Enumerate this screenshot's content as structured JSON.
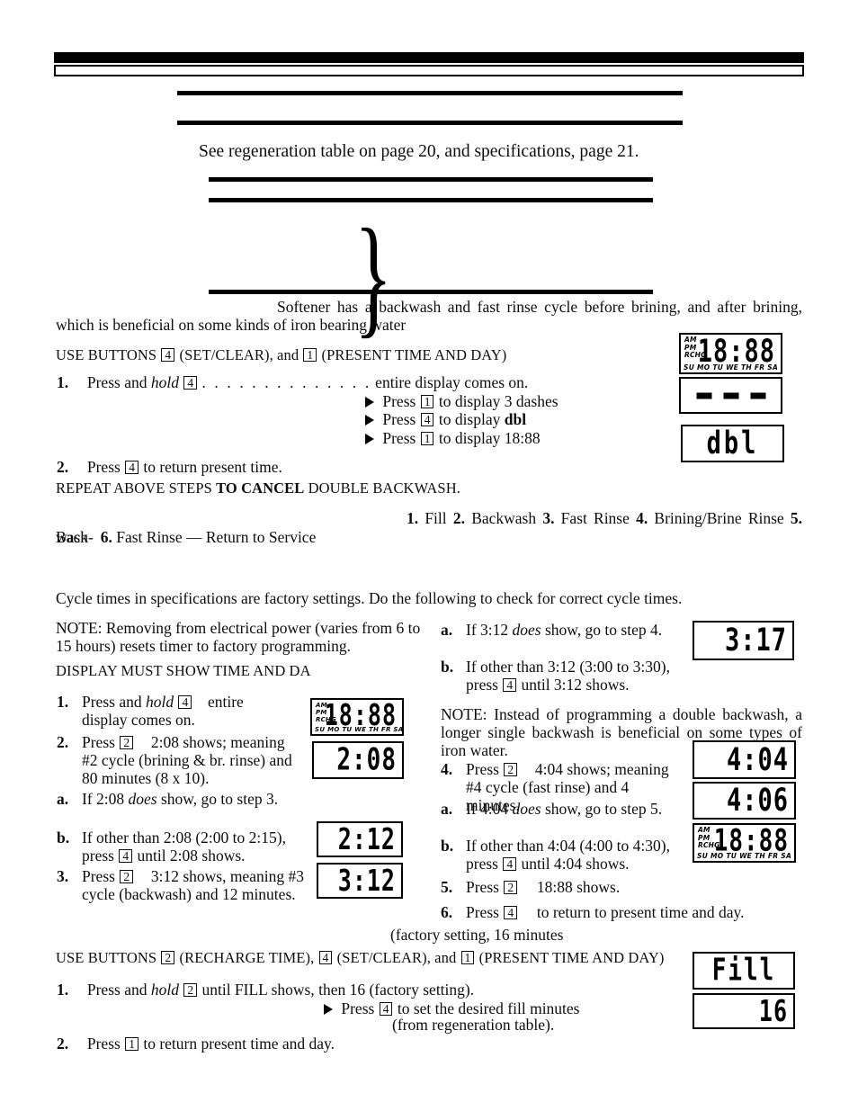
{
  "page": {
    "intro_line": "See regeneration table on page 20, and specifications, page 21.",
    "softener_note": "Softener has a backwash and fast rinse cycle before brining, and after brining, which is beneficial on some kinds of iron bearing water"
  },
  "double_backwash": {
    "use_buttons_prefix": "USE BUTTONS",
    "btn_4": "4",
    "btn_4_label": "(SET/CLEAR), and",
    "btn_1": "1",
    "btn_1_label": "(PRESENT TIME AND DAY)",
    "step1_num": "1.",
    "step1_a": "Press and",
    "step1_hold": "hold",
    "step1_btn": "4",
    "step1_dots": ". . . . . . . . . . . . . .",
    "step1_b": "entire display comes on.",
    "bullets": [
      {
        "press": "Press",
        "btn": "1",
        "text": "to display 3 dashes"
      },
      {
        "press": "Press",
        "btn": "4",
        "text": "to display",
        "bold_tail": "dbl"
      },
      {
        "press": "Press",
        "btn": "1",
        "text": "to display 18:88"
      }
    ],
    "step2_num": "2.",
    "step2_a": "Press",
    "step2_btn": "4",
    "step2_b": "to return present time.",
    "repeat_line_a": "REPEAT ABOVE STEPS",
    "repeat_line_bold": "TO CANCEL",
    "repeat_line_b": "DOUBLE BACKWASH."
  },
  "cycle_list": {
    "items": [
      {
        "n": "1.",
        "label": "Fill"
      },
      {
        "n": "2.",
        "label": "Backwash"
      },
      {
        "n": "3.",
        "label": "Fast Rinse"
      },
      {
        "n": "4.",
        "label": "Brining/Brine Rinse"
      },
      {
        "n": "5.",
        "label": "Back-"
      }
    ],
    "continuation": "wash",
    "cont_n": "6.",
    "cont_label": "Fast Rinse — Return to Service"
  },
  "cycle_check": {
    "lead": "Cycle times in specifications are factory settings. Do the following to check for correct cycle times.",
    "note_power": "NOTE: Removing from electrical power (varies from 6 to 15 hours) resets timer to factory programming.",
    "display_must": "DISPLAY MUST SHOW TIME AND DA",
    "left_steps": [
      {
        "n": "1.",
        "pre": "Press and",
        "ital": "hold",
        "btn": "4",
        "post": "entire display comes on."
      },
      {
        "n": "2.",
        "pre": "Press",
        "btn": "2",
        "post": "2:08 shows; meaning #2 cycle (brining & br. rinse) and 80 minutes (8 x 10)."
      },
      {
        "n": "a.",
        "pre": "If 2:08",
        "ital": "does",
        "post": "show, go to step 3."
      },
      {
        "n": "b.",
        "pre": "If other than 2:08 (2:00 to 2:15), press",
        "btn": "4",
        "post": "until 2:08 shows."
      },
      {
        "n": "3.",
        "pre": "Press",
        "btn": "2",
        "post": "3:12 shows, meaning #3 cycle (backwash) and 12 minutes."
      }
    ],
    "right_steps": [
      {
        "n": "a.",
        "pre": "If 3:12",
        "ital": "does",
        "post": "show, go to step 4."
      },
      {
        "n": "b.",
        "pre": "If other than 3:12 (3:00 to 3:30), press",
        "btn": "4",
        "post": "until 3:12 shows."
      },
      {
        "n": "4.",
        "pre": "Press",
        "btn": "2",
        "post": "4:04 shows; meaning #4 cycle (fast rinse) and 4 minutes."
      },
      {
        "n": "a.",
        "pre": "If 4:04",
        "ital": "does",
        "post": "show, go to step 5."
      },
      {
        "n": "b.",
        "pre": "If other than 4:04 (4:00 to 4:30), press",
        "btn": "4",
        "post": "until 4:04 shows."
      },
      {
        "n": "5.",
        "pre": "Press",
        "btn": "2",
        "post": "18:88 shows."
      },
      {
        "n": "6.",
        "pre": "Press",
        "btn": "4",
        "post": "to return to present time and day."
      }
    ],
    "note_single": "NOTE: Instead of programming a double backwash, a longer single backwash is beneficial on some types of iron water."
  },
  "fill": {
    "factory_setting": "(factory setting, 16 minutes",
    "use_buttons_prefix": "USE BUTTONS",
    "btn_2": "2",
    "btn_2_label": "(RECHARGE TIME),",
    "btn_4": "4",
    "btn_4_label": "(SET/CLEAR), and",
    "btn_1": "1",
    "btn_1_label": "(PRESENT TIME AND DAY)",
    "step1_n": "1.",
    "step1_pre": "Press and",
    "step1_ital": "hold",
    "step1_btn": "2",
    "step1_post": "until FILL shows, then 16 (factory setting).",
    "bullet_press": "Press",
    "bullet_btn": "4",
    "bullet_text": "to set the desired fill minutes",
    "bullet_text2": "(from regeneration table).",
    "step2_n": "2.",
    "step2_pre": "Press",
    "step2_btn": "1",
    "step2_post": "to return present time and day."
  },
  "lcds": {
    "ampm": "AM\nPM\nRCHG",
    "am": "AM",
    "pm": "PM",
    "rchg": "RCHG",
    "days": "SU MO TU WE TH FR SA",
    "d_1888_top": "18:88",
    "d_dbl": "dbl",
    "d_1888_left": "18:88",
    "d_208": "2:08",
    "d_212": "2:12",
    "d_312": "3:12",
    "d_317": "3:17",
    "d_404": "4:04",
    "d_406": "4:06",
    "d_1888_right": "18:88",
    "d_fill": "Fill",
    "d_16": "16"
  },
  "colors": {
    "ink": "#000000",
    "paper": "#ffffff"
  }
}
